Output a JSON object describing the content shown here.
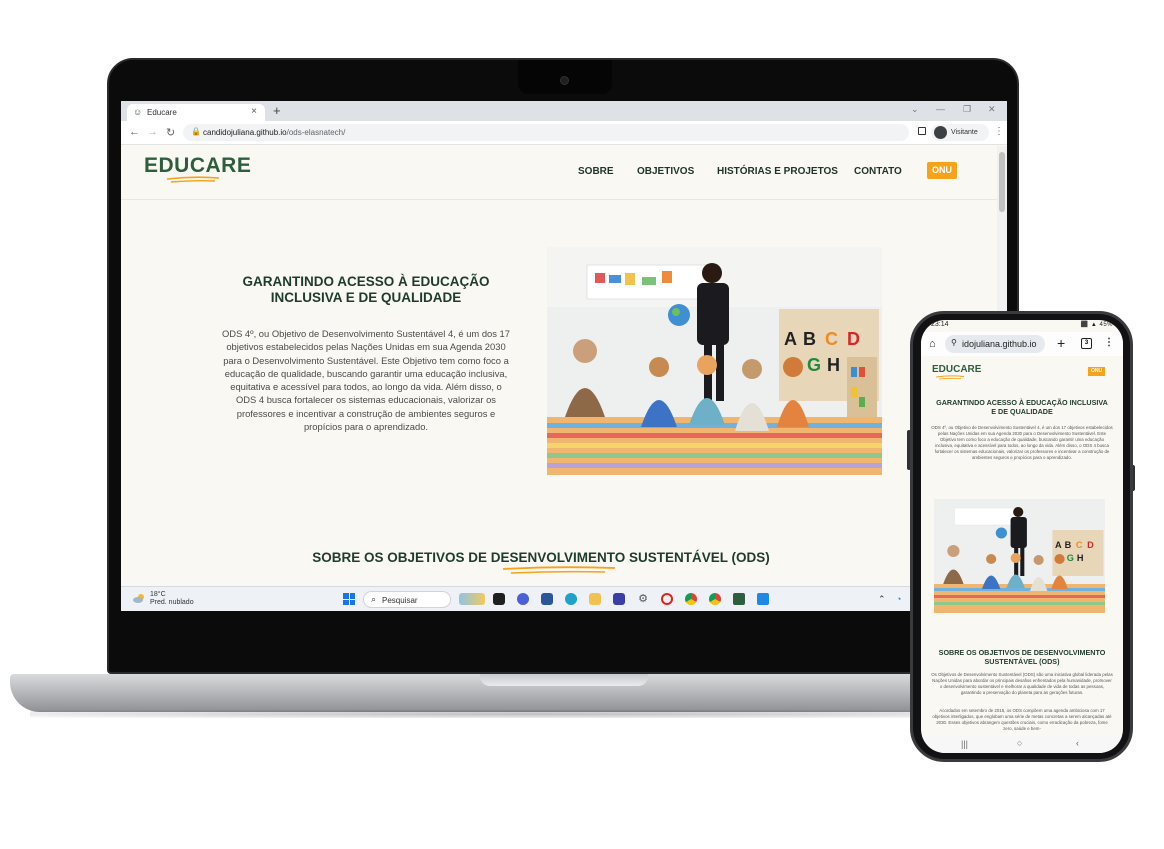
{
  "browser": {
    "tab_title": "Educare",
    "url_host": "candidojuliana.github.io",
    "url_path": "/ods-elasnatech/",
    "profile_label": "Visitante"
  },
  "site": {
    "logo": "EDUCARE",
    "nav": [
      "SOBRE",
      "OBJETIVOS",
      "HISTÓRIAS E PROJETOS",
      "CONTATO"
    ],
    "onu_button": "ONU",
    "hero_title": "GARANTINDO ACESSO À EDUCAÇÃO INCLUSIVA E DE QUALIDADE",
    "hero_text": "ODS 4º, ou Objetivo de Desenvolvimento Sustentável 4, é um dos 17 objetivos estabelecidos pelas Nações Unidas em sua Agenda 2030 para o Desenvolvimento Sustentável. Este Objetivo tem como foco a educação de qualidade, buscando garantir uma educação inclusiva, equitativa e acessível para todos, ao longo da vida. Além disso, o ODS 4 busca fortalecer os sistemas educacionais, valorizar os professores e incentivar a construção de ambientes seguros e propícios para o aprendizado.",
    "section_title": "SOBRE OS OBJETIVOS DE DESENVOLVIMENTO SUSTENTÁVEL (ODS)",
    "section_text_1": "Os Objetivos de Desenvolvimento Sustentável (ODS) são uma iniciativa global liderada pelas Nações Unidas para abordar os principais desafios enfrentados pela humanidade, promover o desenvolvimento sustentável e melhorar a qualidade de vida de todas as pessoas, garantindo a preservação do planeta para as gerações futuras.",
    "section_text_2": "Acordados em setembro de 2015, os ODS compõem uma agenda ambiciosa com 17 objetivos interligados, que englobam uma série de metas concretas a serem alcançadas até 2030. Esses objetivos abrangem questões cruciais, como erradicação da pobreza, fome zero, saúde e bem-"
  },
  "taskbar": {
    "temperature": "18°C",
    "weather": "Pred. nublado",
    "search": "Pesquisar"
  },
  "phone": {
    "time": "23:14",
    "status_icons": "⬛ ▲ 45%",
    "url": "idojuliana.github.io",
    "tab_count": "3"
  },
  "colors": {
    "brand_green": "#2e5e3e",
    "accent_orange": "#f6a21a",
    "page_bg": "#faf8f3"
  }
}
